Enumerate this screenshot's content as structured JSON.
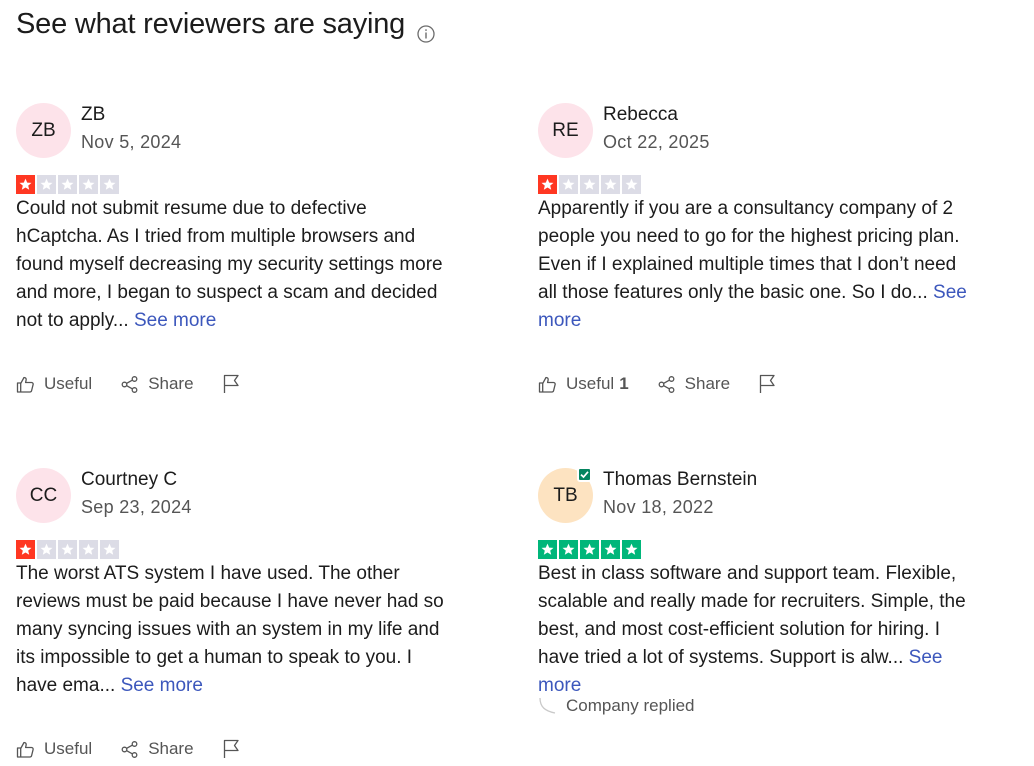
{
  "page": {
    "title": "See what reviewers are saying"
  },
  "colors": {
    "star_red": "#ff3722",
    "star_green": "#00b67a",
    "star_empty": "#dcdce6",
    "link": "#3c57bc",
    "avatar_pink": "#fde3ea",
    "avatar_orange": "#fde3c1",
    "verified": "#04845f"
  },
  "reviews": [
    {
      "initials": "ZB",
      "name": "ZB",
      "date": "Nov 5, 2024",
      "rating": 1,
      "text": "Could not submit resume due to defective hCaptcha. As I tried from multiple browsers and found myself decreasing my security settings more and more, I began to suspect a scam and decided not to apply...",
      "see_more": "See more",
      "useful_label": "Useful",
      "useful_count": "",
      "share_label": "Share",
      "verified": false
    },
    {
      "initials": "RE",
      "name": "Rebecca",
      "date": "Oct 22, 2025",
      "rating": 1,
      "text": "Apparently if you are a consultancy company of 2 people you need to go for the highest pricing plan. Even if I explained multiple times that I don’t need all those features only the basic one. So I do...",
      "see_more": "See more",
      "useful_label": "Useful",
      "useful_count": "1",
      "share_label": "Share",
      "verified": false
    },
    {
      "initials": "CC",
      "name": "Courtney C",
      "date": "Sep 23, 2024",
      "rating": 1,
      "text": "The worst ATS system I have used. The other reviews must be paid because I have never had so many syncing issues with an system in my life and its impossible to get a human to speak to you. I have ema...",
      "see_more": "See more",
      "useful_label": "Useful",
      "useful_count": "",
      "share_label": "Share",
      "verified": false
    },
    {
      "initials": "TB",
      "name": "Thomas Bernstein",
      "date": "Nov 18, 2022",
      "rating": 5,
      "text": "Best in class software and support team. Flexible, scalable and really made for recruiters. Simple, the best, and most cost-efficient solution for hiring. I have tried a lot of systems. Support is alw...",
      "see_more": "See more",
      "company_replied": "Company replied",
      "verified": true
    }
  ]
}
